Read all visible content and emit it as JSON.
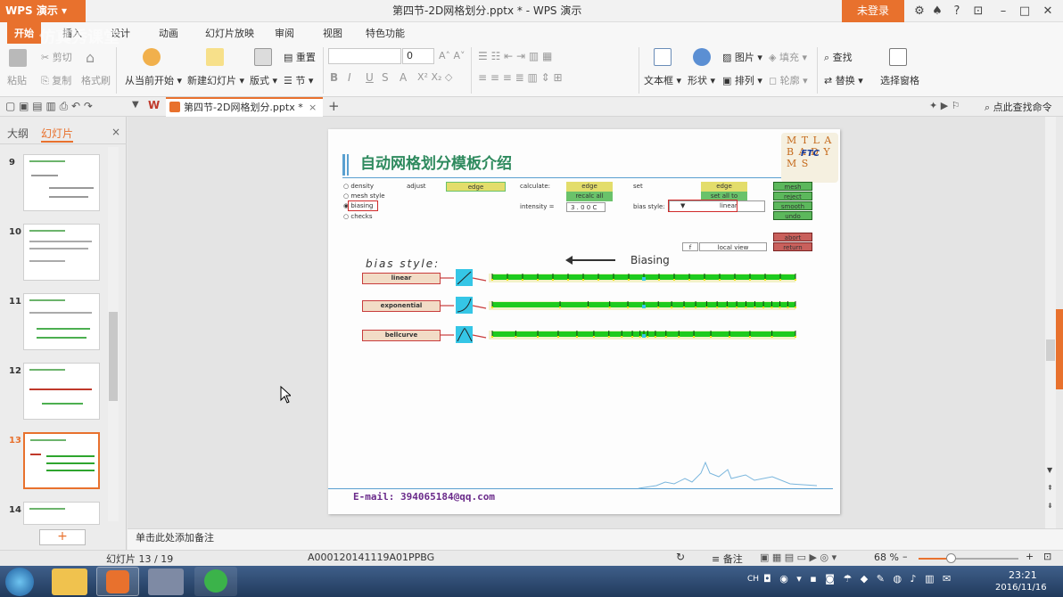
{
  "app": {
    "name": "WPS 演示",
    "doc_title": "第四节-2D网格划分.pptx * - WPS 演示",
    "login": "未登录"
  },
  "menu": {
    "tabs": [
      "开始",
      "插入",
      "设计",
      "动画",
      "幻灯片放映",
      "审阅",
      "视图",
      "特色功能"
    ],
    "active": 0,
    "watermark": "仿真秀课堂"
  },
  "ribbon": {
    "paste": "粘贴",
    "cut": "剪切",
    "copy": "复制",
    "format_painter": "格式刷",
    "play_from_current": "从当前开始",
    "new_slide": "新建幻灯片",
    "layout": "版式",
    "reset": "重置",
    "section": "节",
    "font_size": "0",
    "textbox": "文本框",
    "shape": "形状",
    "picture": "图片",
    "fill": "填充",
    "arrange": "排列",
    "outline": "轮廓",
    "find": "查找",
    "replace": "替换",
    "selection_pane": "选择窗格",
    "bold": "B",
    "italic": "I",
    "underline": "U",
    "strike": "S",
    "shadow": "A"
  },
  "doc_tab": {
    "label": "第四节-2D网格划分.pptx *",
    "close": "×",
    "add": "+",
    "search": "点此查找命令"
  },
  "left_panel": {
    "tab_outline": "大纲",
    "tab_slides": "幻灯片",
    "close": "×",
    "add": "+",
    "slides": [
      {
        "num": "9"
      },
      {
        "num": "10"
      },
      {
        "num": "11"
      },
      {
        "num": "12"
      },
      {
        "num": "13"
      },
      {
        "num": "14"
      }
    ],
    "selected": "13"
  },
  "slide": {
    "title": "自动网格划分模板介绍",
    "logo": {
      "letters": "M T L A B A D Y M S",
      "ftc": "FTC"
    },
    "radio": [
      "density",
      "mesh style",
      "biasing",
      "checks"
    ],
    "adjust_label": "adjust",
    "adjust_value": "edge",
    "calculate_label": "calculate:",
    "calc_edge": "edge",
    "recalc_all": "recalc all",
    "intensity_label": "intensity =",
    "intensity_value": "3 . 0 0 C",
    "set_label": "set",
    "set_edge": "edge",
    "set_all_to": "set all to",
    "bias_style_label": "bias style:",
    "bias_style_value": "linear",
    "actions": [
      "mesh",
      "reject",
      "smooth",
      "undo"
    ],
    "abort": "abort",
    "return": "return",
    "f_btn": "f",
    "local_view": "local view",
    "biasing_arrow_label": "Biasing",
    "bias_style_heading": "bias style:",
    "styles": [
      "linear",
      "exponential",
      "bellcurve"
    ],
    "email": "E-mail: 394065184@qq.com"
  },
  "notes": "单击此处添加备注",
  "status": {
    "slide_info": "幻灯片 13 / 19",
    "theme": "A000120141119A01PPBG",
    "notes": "备注",
    "zoom": "68 %"
  },
  "taskbar": {
    "lang": "CH",
    "time": "23:21",
    "date": "2016/11/16"
  },
  "colors": {
    "accent": "#e8712d",
    "green": "#2ea52e",
    "slide_title": "#2e8a5e",
    "cyan": "#35c6e6"
  }
}
